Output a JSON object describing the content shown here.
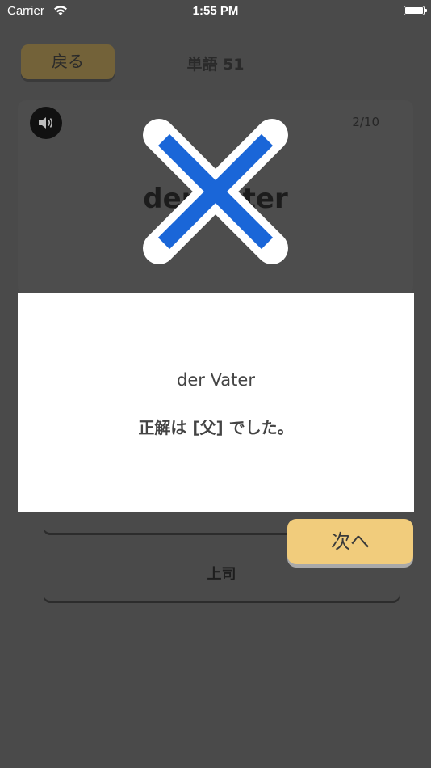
{
  "status_bar": {
    "carrier": "Carrier",
    "time": "1:55 PM",
    "wifi_icon": "wifi-icon",
    "battery_icon": "battery-icon"
  },
  "header": {
    "back_label": "戻る",
    "title": "単語 51"
  },
  "card": {
    "speaker_icon": "speaker-icon",
    "progress": "2/10",
    "word": "der Vater"
  },
  "options": [
    {
      "label": ""
    },
    {
      "label": "上司"
    }
  ],
  "result": {
    "mark_icon": "cross-icon",
    "word": "der Vater",
    "message": "正解は [父] でした。"
  },
  "next_button": {
    "label": "次へ"
  },
  "colors": {
    "accent": "#f1cc7c",
    "cross_blue": "#1a66d8",
    "overlay": "#4a4a4a"
  }
}
